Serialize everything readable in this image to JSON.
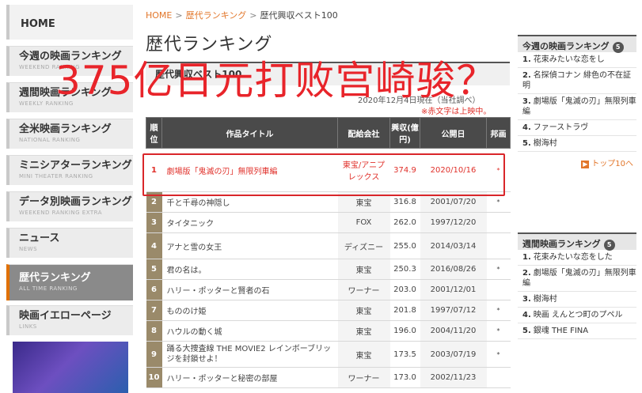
{
  "overlay_headline": "375亿日元打败宫崎骏？",
  "sidebar": {
    "home": "HOME",
    "items": [
      {
        "label": "今週の映画ランキング",
        "sub": "WEEKEND RANKING"
      },
      {
        "label": "週間映画ランキング",
        "sub": "WEEKLY RANKING"
      },
      {
        "label": "全米映画ランキング",
        "sub": "NATIONAL RANKING"
      },
      {
        "label": "ミニシアターランキング",
        "sub": "MINI THEATER RANKING"
      },
      {
        "label": "データ別映画ランキング",
        "sub": "WEEKEND RANKING EXTRA"
      },
      {
        "label": "ニュース",
        "sub": "NEWS"
      },
      {
        "label": "歴代ランキング",
        "sub": "ALL TIME RANKING"
      },
      {
        "label": "映画イエローページ",
        "sub": "LINKS"
      }
    ]
  },
  "breadcrumb": {
    "home": "HOME",
    "sep": ">",
    "section": "歴代ランキング",
    "current": "歴代興収ベスト100"
  },
  "page_title": "歴代ランキング",
  "subtitle": "歴代興収ベスト100",
  "date_note": "2020年12月4日現在（当社調べ）",
  "red_note": "※赤文字は上映中。",
  "table": {
    "headers": {
      "rank": "順位",
      "title": "作品タイトル",
      "distributor": "配給会社",
      "gross": "興収(億円)",
      "date": "公開日",
      "mark": "邦画"
    },
    "rows": [
      {
        "rank": "1",
        "title": "劇場版「鬼滅の刃」無限列車編",
        "distributor": "東宝/アニプレックス",
        "gross": "374.9",
        "date": "2020/10/16",
        "mark": "*"
      },
      {
        "rank": "2",
        "title": "千と千尋の神隠し",
        "distributor": "東宝",
        "gross": "316.8",
        "date": "2001/07/20",
        "mark": "*"
      },
      {
        "rank": "3",
        "title": "タイタニック",
        "distributor": "FOX",
        "gross": "262.0",
        "date": "1997/12/20",
        "mark": ""
      },
      {
        "rank": "4",
        "title": "アナと雪の女王",
        "distributor": "ディズニー",
        "gross": "255.0",
        "date": "2014/03/14",
        "mark": ""
      },
      {
        "rank": "5",
        "title": "君の名は。",
        "distributor": "東宝",
        "gross": "250.3",
        "date": "2016/08/26",
        "mark": "*"
      },
      {
        "rank": "6",
        "title": "ハリー・ポッターと賢者の石",
        "distributor": "ワーナー",
        "gross": "203.0",
        "date": "2001/12/01",
        "mark": ""
      },
      {
        "rank": "7",
        "title": "もののけ姫",
        "distributor": "東宝",
        "gross": "201.8",
        "date": "1997/07/12",
        "mark": "*"
      },
      {
        "rank": "8",
        "title": "ハウルの動く城",
        "distributor": "東宝",
        "gross": "196.0",
        "date": "2004/11/20",
        "mark": "*"
      },
      {
        "rank": "9",
        "title": "踊る大捜査線 THE MOVIE2 レインボーブリッジを封鎖せよ！",
        "distributor": "東宝",
        "gross": "173.5",
        "date": "2003/07/19",
        "mark": "*"
      },
      {
        "rank": "10",
        "title": "ハリー・ポッターと秘密の部屋",
        "distributor": "ワーナー",
        "gross": "173.0",
        "date": "2002/11/23",
        "mark": ""
      }
    ]
  },
  "right_weekend": {
    "title": "今週の映画ランキング",
    "badge": "5",
    "items": [
      {
        "n": "1.",
        "text": "花束みたいな恋をし"
      },
      {
        "n": "2.",
        "text": "名探偵コナン 緋色の不在証明"
      },
      {
        "n": "3.",
        "text": "劇場版「鬼滅の刃」無限列車編"
      },
      {
        "n": "4.",
        "text": "ファーストラヴ"
      },
      {
        "n": "5.",
        "text": "樹海村"
      }
    ],
    "more": "トップ10へ"
  },
  "right_weekly": {
    "title": "週間映画ランキング",
    "badge": "5",
    "items": [
      {
        "n": "1.",
        "text": "花束みたいな恋をした"
      },
      {
        "n": "2.",
        "text": "劇場版「鬼滅の刃」無限列車編"
      },
      {
        "n": "3.",
        "text": "樹海村"
      },
      {
        "n": "4.",
        "text": "映画 えんとつ町のプペル"
      },
      {
        "n": "5.",
        "text": "銀魂 THE FINA"
      }
    ]
  },
  "colors": {
    "accent": "#e2762a",
    "highlight": "#d9262a",
    "overlay": "#e8242a",
    "header": "#4a4a4a"
  }
}
